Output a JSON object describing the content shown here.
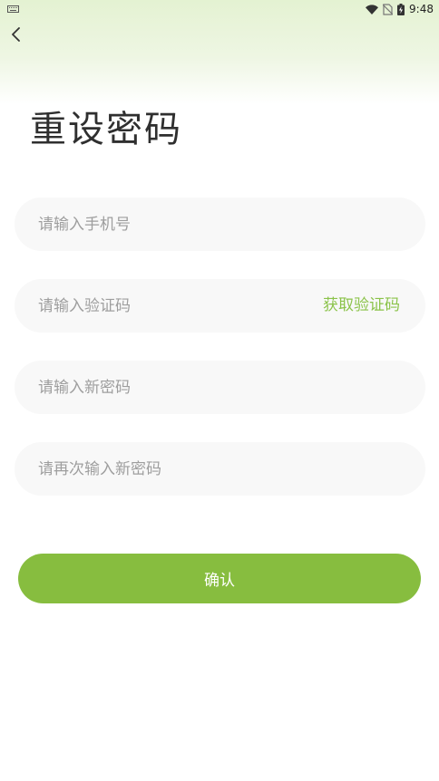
{
  "status_bar": {
    "time": "9:48"
  },
  "colors": {
    "accent": "#87bd3f",
    "link": "#8bc34a",
    "field_bg": "#f8f8f8",
    "header_tint": "#e4f2d2"
  },
  "icons": [
    "keyboard-icon",
    "wifi-icon",
    "no-sim-icon",
    "battery-charging-icon",
    "back-arrow-icon"
  ],
  "page": {
    "title": "重设密码"
  },
  "form": {
    "phone_placeholder": "请输入手机号",
    "code_placeholder": "请输入验证码",
    "get_code_label": "获取验证码",
    "new_password_placeholder": "请输入新密码",
    "confirm_password_placeholder": "请再次输入新密码",
    "confirm_label": "确认"
  }
}
